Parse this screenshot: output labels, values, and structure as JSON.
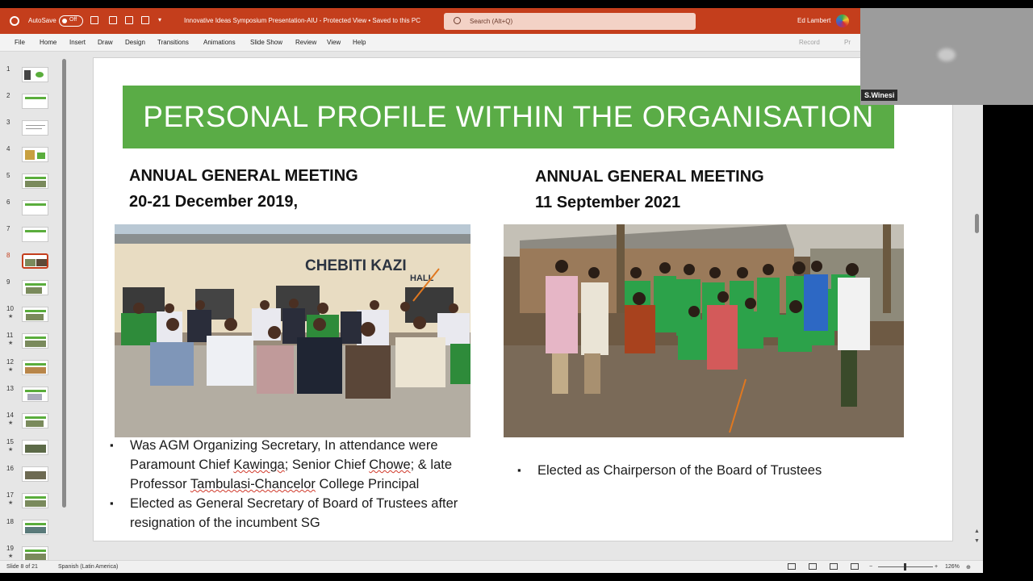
{
  "titlebar": {
    "autosave_label": "AutoSave",
    "autosave_state": "Off",
    "document_title": "Innovative Ideas Symposium Presentation-AIU  -  Protected View • Saved to this PC",
    "search_placeholder": "Search (Alt+Q)",
    "user_name": "Ed Lambert",
    "accent_color": "#c43e1c"
  },
  "ribbon": {
    "tabs": [
      "File",
      "Home",
      "Insert",
      "Draw",
      "Design",
      "Transitions",
      "Animations",
      "Slide Show",
      "Review",
      "View",
      "Help"
    ],
    "record_label": "Record",
    "present_label": "Pr"
  },
  "thumbnails": {
    "numbers": [
      "1",
      "2",
      "3",
      "4",
      "5",
      "6",
      "7",
      "8",
      "9",
      "10",
      "11",
      "12",
      "13",
      "14",
      "15",
      "16",
      "17",
      "18",
      "19"
    ],
    "selected": 8,
    "star_mark": "★"
  },
  "slide": {
    "title": "PERSONAL PROFILE WITHIN THE ORGANISATION",
    "title_bg": "#5aac46",
    "left": {
      "heading_line1": "ANNUAL GENERAL MEETING",
      "heading_line2": "20-21 December 2019,",
      "photo_sign": "CHEBITI KAZI",
      "photo_sign2": "HALL",
      "bullet1_pre": "Was AGM Organizing Secretary, In attendance were Paramount Chief ",
      "bullet1_w1": "Kawinga",
      "bullet1_mid": "; Senior Chief ",
      "bullet1_w2": "Chowe",
      "bullet1_mid2": "; & late Professor ",
      "bullet1_w3": "Tambulasi-Chancelor",
      "bullet1_post": " College Principal",
      "bullet2": "Elected as General Secretary  of Board of Trustees after resignation of the incumbent SG"
    },
    "right": {
      "heading_line1": "ANNUAL GENERAL MEETING",
      "heading_line2": "11 September 2021",
      "bullet1": "Elected as Chairperson of the Board of Trustees"
    }
  },
  "status": {
    "slide_info": "Slide 8 of 21",
    "language": "Spanish (Latin America)",
    "zoom": "126%"
  },
  "video": {
    "participant": "S.Winesi"
  }
}
